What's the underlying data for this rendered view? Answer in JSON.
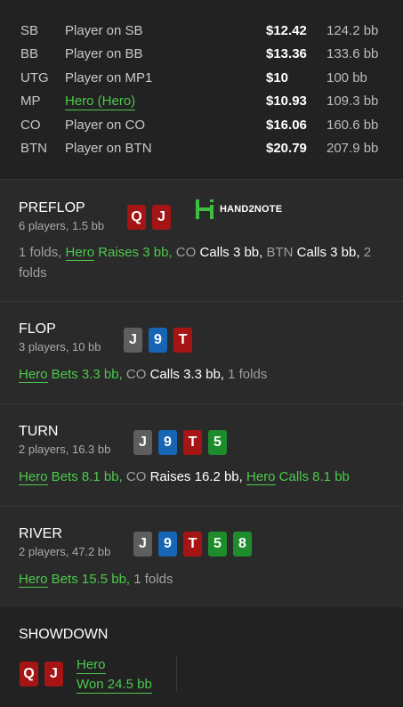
{
  "players": [
    {
      "pos": "SB",
      "name": "Player on SB",
      "hero": false,
      "stack": "$12.42",
      "bb": "124.2 bb"
    },
    {
      "pos": "BB",
      "name": "Player on BB",
      "hero": false,
      "stack": "$13.36",
      "bb": "133.6 bb"
    },
    {
      "pos": "UTG",
      "name": "Player on MP1",
      "hero": false,
      "stack": "$10",
      "bb": "100 bb"
    },
    {
      "pos": "MP",
      "name": "Hero (Hero)",
      "hero": true,
      "stack": "$10.93",
      "bb": "109.3 bb"
    },
    {
      "pos": "CO",
      "name": "Player on CO",
      "hero": false,
      "stack": "$16.06",
      "bb": "160.6 bb"
    },
    {
      "pos": "BTN",
      "name": "Player on BTN",
      "hero": false,
      "stack": "$20.79",
      "bb": "207.9 bb"
    }
  ],
  "logo": {
    "text": "HAND2NOTE",
    "color": "#3fbf3f"
  },
  "preflop": {
    "name": "PREFLOP",
    "info": "6 players, 1.5 bb",
    "cards": [
      {
        "r": "Q",
        "color": "red"
      },
      {
        "r": "J",
        "color": "red"
      }
    ],
    "actions": {
      "a1": "1 folds, ",
      "hero": "Hero",
      "a2": " Raises 3 bb, ",
      "a3": "CO ",
      "a4": "Calls 3 bb, ",
      "a5": "BTN ",
      "a6": "Calls 3 bb, ",
      "a7": "2 folds"
    }
  },
  "flop": {
    "name": "FLOP",
    "info": "3 players, 10 bb",
    "cards": [
      {
        "r": "J",
        "color": "gray"
      },
      {
        "r": "9",
        "color": "blue"
      },
      {
        "r": "T",
        "color": "red"
      }
    ],
    "actions": {
      "hero": "Hero",
      "a1": " Bets 3.3 bb, ",
      "a2": "CO ",
      "a3": "Calls 3.3 bb, ",
      "a4": "1 folds"
    }
  },
  "turn": {
    "name": "TURN",
    "info": "2 players, 16.3 bb",
    "cards": [
      {
        "r": "J",
        "color": "gray"
      },
      {
        "r": "9",
        "color": "blue"
      },
      {
        "r": "T",
        "color": "red"
      },
      {
        "r": "5",
        "color": "green"
      }
    ],
    "actions": {
      "hero": "Hero",
      "a1": " Bets 8.1 bb, ",
      "a2": "CO ",
      "a3": "Raises 16.2 bb, ",
      "hero2": "Hero",
      "a4": " Calls 8.1 bb"
    }
  },
  "river": {
    "name": "RIVER",
    "info": "2 players, 47.2 bb",
    "cards": [
      {
        "r": "J",
        "color": "gray"
      },
      {
        "r": "9",
        "color": "blue"
      },
      {
        "r": "T",
        "color": "red"
      },
      {
        "r": "5",
        "color": "green"
      },
      {
        "r": "8",
        "color": "green"
      }
    ],
    "actions": {
      "hero": "Hero",
      "a1": " Bets 15.5 bb, ",
      "a2": "1 folds"
    }
  },
  "showdown": {
    "name": "SHOWDOWN",
    "cards": [
      {
        "r": "Q",
        "color": "red"
      },
      {
        "r": "J",
        "color": "red"
      }
    ],
    "player": "Hero",
    "result": "Won 24.5 bb"
  }
}
